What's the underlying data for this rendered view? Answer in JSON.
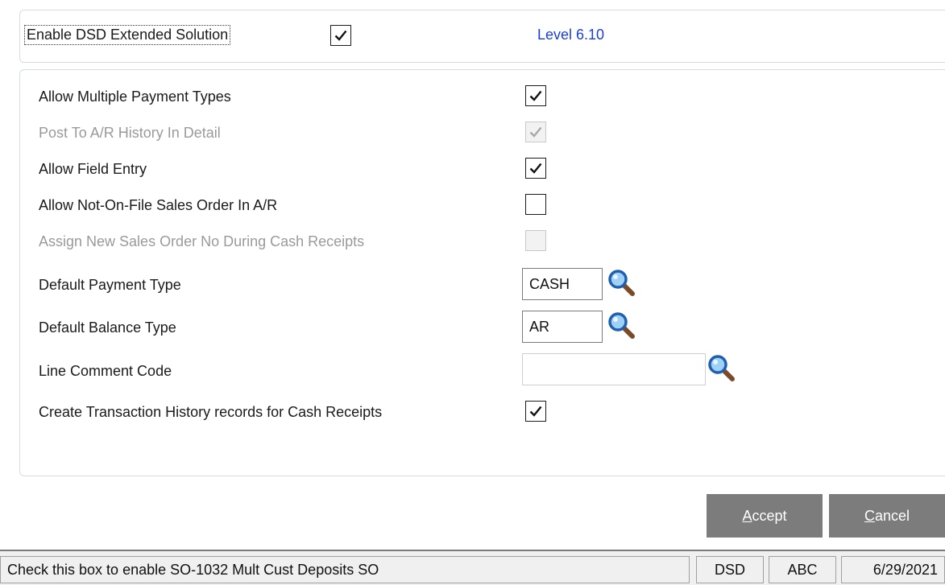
{
  "header": {
    "enable_label": "Enable DSD Extended Solution",
    "enable_checked": true,
    "level_text": "Level  6.10"
  },
  "options": [
    {
      "label": "Allow Multiple Payment Types",
      "checked": true,
      "disabled": false
    },
    {
      "label": "Post To A/R History In Detail",
      "checked": true,
      "disabled": true
    },
    {
      "label": "Allow Field Entry",
      "checked": true,
      "disabled": false
    },
    {
      "label": "Allow Not-On-File Sales Order In A/R",
      "checked": false,
      "disabled": false
    },
    {
      "label": "Assign New Sales Order No During Cash Receipts",
      "checked": false,
      "disabled": true
    }
  ],
  "fields": {
    "payment_type": {
      "label": "Default Payment Type",
      "value": "CASH"
    },
    "balance_type": {
      "label": "Default Balance Type",
      "value": "AR"
    },
    "line_comment": {
      "label": "Line Comment Code",
      "value": ""
    }
  },
  "history": {
    "label": "Create Transaction History records for Cash Receipts",
    "checked": true
  },
  "buttons": {
    "accept_first": "A",
    "accept_rest": "ccept",
    "cancel_first": "C",
    "cancel_rest": "ancel"
  },
  "icons": {
    "lookup": "magnifier-lookup-icon",
    "check": "checkmark-icon"
  },
  "colors": {
    "level": "#1a3fd6",
    "button": "#7c7c7c",
    "disabled_text": "#9a9a9a"
  },
  "status": {
    "message": "Check this box to enable SO-1032  Mult Cust Deposits SO",
    "module": "DSD",
    "company": "ABC",
    "date": "6/29/2021"
  }
}
